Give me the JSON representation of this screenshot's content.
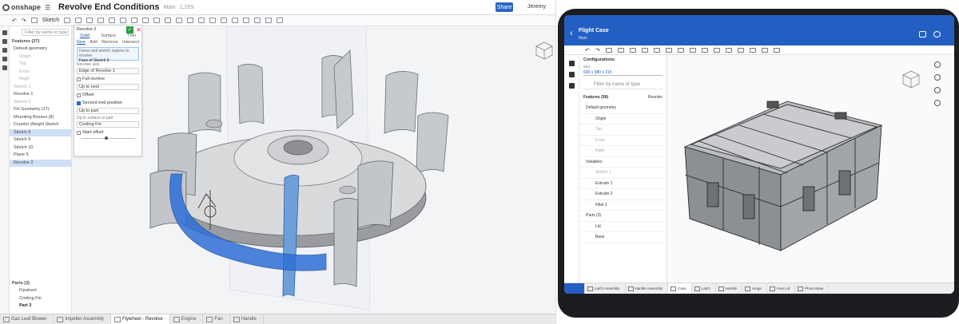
{
  "desktop": {
    "logo": "onshape",
    "doc_title": "Revolve End Conditions",
    "branch": "Main",
    "version": "1,209",
    "share_label": "Share",
    "user": "Jeremy",
    "toolbar": {
      "sketch_label": "Sketch"
    },
    "features": {
      "search_placeholder": "Filter by name or type",
      "header": "Features (37)",
      "items": [
        "Default geometry",
        "Origin",
        "Top",
        "Front",
        "Right",
        "Sketch 1",
        "Revolve 1",
        "Sketch 2",
        "Fin Geometry (17)",
        "Mounting Bosses (8)",
        "Counter Weight Sketch",
        "Sketch 5",
        "Sketch 6",
        "Sketch 10",
        "Plane 5",
        "Revolve 2"
      ],
      "parts_header": "Parts (3)",
      "parts": [
        "Flywheel",
        "Cooling Fin",
        "Part 3"
      ]
    },
    "dialog": {
      "title": "Revolve 2",
      "types": [
        "Solid",
        "Surface",
        "Thin"
      ],
      "ops": [
        "New",
        "Add",
        "Remove",
        "Intersect"
      ],
      "faces_label": "Faces and sketch regions to revolve",
      "faces_value": "Face of Sketch 5",
      "axis_label": "Revolve axis",
      "axis_value": "Edge of Revolve 1",
      "full_revolve": "Full revolve",
      "end_type": "Up to next",
      "offset": "Offset",
      "second_dir": "Second end position",
      "second_type": "Up to part",
      "up_to_label": "Up to surface or part",
      "up_to_value": "Cooling Fin",
      "start_offset": "Start offset"
    },
    "tabs": [
      "Gas Leaf Blower",
      "Impeller Assembly",
      "Flywheel - Revolve",
      "Engine",
      "Fan",
      "Handle"
    ]
  },
  "tablet": {
    "title": "Flight Case",
    "subtitle": "Main",
    "configurations": "Configurations",
    "size_label": "Size",
    "size_value": "600 x 380 x 215",
    "search_placeholder": "Filter by name or type",
    "features_header": "Features (58)",
    "rollback": "Reorder",
    "rows": [
      "Default geometry",
      "Origin",
      "Top",
      "Front",
      "Right",
      "Variables",
      "Sketch 1",
      "Extrude 1",
      "Extrude 2",
      "Fillet 1"
    ],
    "parts_header": "Parts (3)",
    "parts": [
      "Lid",
      "Base"
    ],
    "tabs": [
      "Latch Assembly",
      "Handle Assembly",
      "Case",
      "Latch",
      "Handle",
      "Hinge",
      "Feet Lid",
      "Photo Base"
    ]
  },
  "colors": {
    "onshape_blue": "#2c66c4",
    "tablet_header": "#235fc2",
    "selection_blue": "#2f6fd6",
    "confirm_green": "#2e9c3f"
  }
}
